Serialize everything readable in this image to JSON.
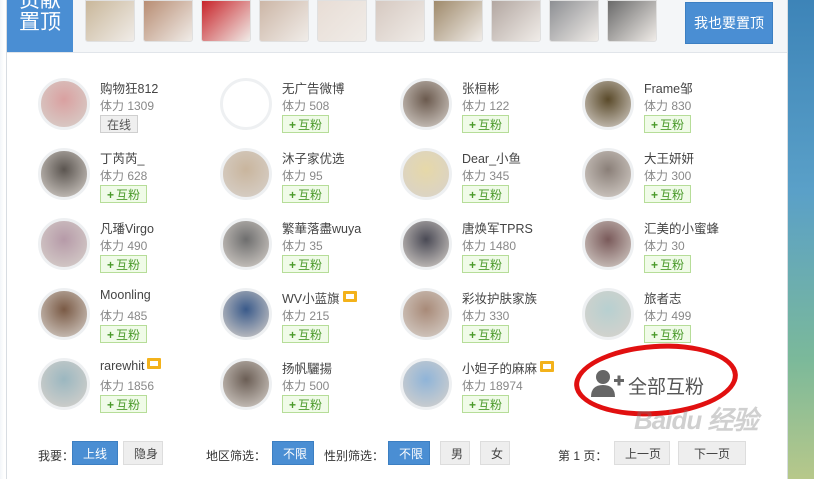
{
  "top": {
    "badge_line1": "贡献",
    "badge_line2": "置顶",
    "button_label": "我也要置顶",
    "avatars": [
      {
        "icon": "avatar-photo-cartoon",
        "color": "#c9b79a"
      },
      {
        "icon": "avatar-photo-woman",
        "color": "#b88d73"
      },
      {
        "icon": "avatar-logo-red",
        "color": "#c8242a"
      },
      {
        "icon": "avatar-photo-woman-sunglasses",
        "color": "#ccb6a6"
      },
      {
        "icon": "avatar-drawing-girl",
        "color": "#e8ddd5"
      },
      {
        "icon": "avatar-photo-woman",
        "color": "#d6c9c1"
      },
      {
        "icon": "avatar-photo-objects",
        "color": "#9f8a6b"
      },
      {
        "icon": "avatar-photo-girl",
        "color": "#b3a7a1"
      },
      {
        "icon": "avatar-photo-man",
        "color": "#8d8f93"
      },
      {
        "icon": "avatar-photo-man-dark",
        "color": "#6a6a6a"
      }
    ]
  },
  "users": [
    {
      "name": "购物狂812",
      "stamina": "体力 1309",
      "button": "在线",
      "type": "online",
      "avatar_color": "#d9a0a0",
      "crown": false
    },
    {
      "name": "无广告微博",
      "stamina": "体力 508",
      "button": "互粉",
      "type": "follow",
      "avatar_color": "#ffffff",
      "crown": false
    },
    {
      "name": "张桓彬",
      "stamina": "体力 122",
      "button": "互粉",
      "type": "follow",
      "avatar_color": "#6b5a4e",
      "crown": false
    },
    {
      "name": "Frame邹",
      "stamina": "体力 830",
      "button": "互粉",
      "type": "follow",
      "avatar_color": "#5a4a2a",
      "crown": false
    },
    {
      "name": "丁芮芮_",
      "stamina": "体力 628",
      "button": "互粉",
      "type": "follow",
      "avatar_color": "#5b5550",
      "crown": false
    },
    {
      "name": "沐子家优选",
      "stamina": "体力 95",
      "button": "互粉",
      "type": "follow",
      "avatar_color": "#c9b59d",
      "crown": false
    },
    {
      "name": "Dear_小鱼",
      "stamina": "体力 345",
      "button": "互粉",
      "type": "follow",
      "avatar_color": "#e6d8a8",
      "crown": false
    },
    {
      "name": "大王妍妍",
      "stamina": "体力 300",
      "button": "互粉",
      "type": "follow",
      "avatar_color": "#8a7f78",
      "crown": false
    },
    {
      "name": "凡璠Virgo",
      "stamina": "体力 490",
      "button": "互粉",
      "type": "follow",
      "avatar_color": "#b69aa8",
      "crown": false
    },
    {
      "name": "繁華落盡wuya",
      "stamina": "体力 35",
      "button": "互粉",
      "type": "follow",
      "avatar_color": "#6e6e6e",
      "crown": false
    },
    {
      "name": "唐焕军TPRS",
      "stamina": "体力 1480",
      "button": "互粉",
      "type": "follow",
      "avatar_color": "#4a4a55",
      "crown": false
    },
    {
      "name": "汇美的小蜜蜂",
      "stamina": "体力 30",
      "button": "互粉",
      "type": "follow",
      "avatar_color": "#7a5a5a",
      "crown": false
    },
    {
      "name": "Moonling",
      "stamina": "体力 485",
      "button": "互粉",
      "type": "follow",
      "avatar_color": "#7a5a45",
      "crown": false
    },
    {
      "name": "WV小蓝旗",
      "stamina": "体力 215",
      "button": "互粉",
      "type": "follow",
      "avatar_color": "#3a5a8a",
      "crown": true
    },
    {
      "name": "彩妆护肤家族",
      "stamina": "体力 330",
      "button": "互粉",
      "type": "follow",
      "avatar_color": "#a88a78",
      "crown": false
    },
    {
      "name": "旅者志",
      "stamina": "体力 499",
      "button": "互粉",
      "type": "follow",
      "avatar_color": "#b7d0d0",
      "crown": false
    },
    {
      "name": "rarewhit",
      "stamina": "体力 1856",
      "button": "互粉",
      "type": "follow",
      "avatar_color": "#9bb7c0",
      "crown": true
    },
    {
      "name": "扬帆驪揚",
      "stamina": "体力 500",
      "button": "互粉",
      "type": "follow",
      "avatar_color": "#6b5e55",
      "crown": false
    },
    {
      "name": "小妲子的麻麻",
      "stamina": "体力 18974",
      "button": "互粉",
      "type": "follow",
      "avatar_color": "#8fb4d8",
      "crown": true
    }
  ],
  "all_mutual": {
    "label": "全部互粉",
    "icon": "add-user-icon"
  },
  "footer": {
    "status_label": "我要：",
    "online_btn": "上线",
    "hide_btn": "隐身",
    "region_label": "地区筛选：",
    "region_value": "不限",
    "gender_label": "性别筛选：",
    "gender_all": "不限",
    "gender_male": "男",
    "gender_female": "女",
    "page_label": "第 1 页：",
    "prev_btn": "上一页",
    "next_btn": "下一页"
  },
  "watermark": "Baidu 经验",
  "colors": {
    "accent": "#4a8ed3",
    "follow_green": "#4a9a2a",
    "annotation_red": "#e11010"
  }
}
